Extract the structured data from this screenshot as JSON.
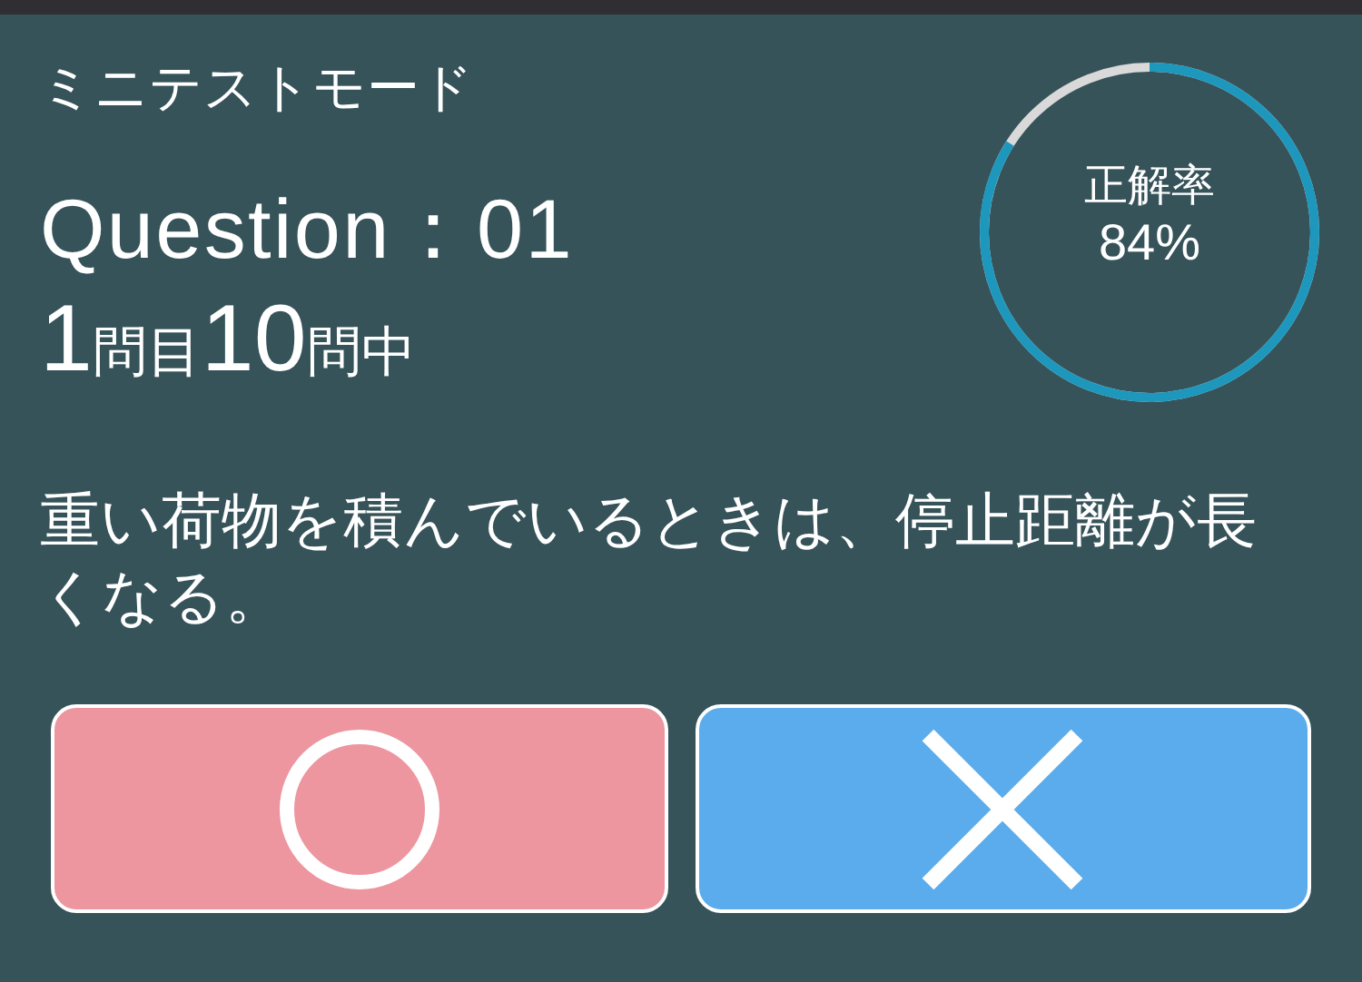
{
  "mode_title": "ミニテストモード",
  "question_label": "Question：01",
  "progress_parts": [
    {
      "text": "1",
      "kind": "number"
    },
    {
      "text": "問目",
      "kind": "unit"
    },
    {
      "text": "10",
      "kind": "number"
    },
    {
      "text": "問中",
      "kind": "unit"
    }
  ],
  "accuracy": {
    "label": "正解率",
    "value": "84%",
    "level": 0.84
  },
  "question_text": "重い荷物を積んでいるときは、停止距離が長くなる。",
  "answers": [
    {
      "kind": "circle"
    },
    {
      "kind": "cross"
    }
  ]
}
